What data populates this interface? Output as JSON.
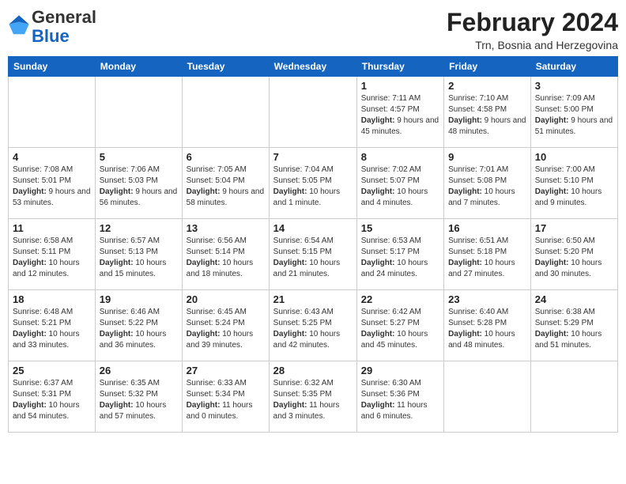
{
  "header": {
    "logo_general": "General",
    "logo_blue": "Blue",
    "month_year": "February 2024",
    "location": "Trn, Bosnia and Herzegovina"
  },
  "weekdays": [
    "Sunday",
    "Monday",
    "Tuesday",
    "Wednesday",
    "Thursday",
    "Friday",
    "Saturday"
  ],
  "weeks": [
    [
      {
        "day": "",
        "info": ""
      },
      {
        "day": "",
        "info": ""
      },
      {
        "day": "",
        "info": ""
      },
      {
        "day": "",
        "info": ""
      },
      {
        "day": "1",
        "sunrise": "Sunrise: 7:11 AM",
        "sunset": "Sunset: 4:57 PM",
        "daylight": "Daylight: 9 hours and 45 minutes."
      },
      {
        "day": "2",
        "sunrise": "Sunrise: 7:10 AM",
        "sunset": "Sunset: 4:58 PM",
        "daylight": "Daylight: 9 hours and 48 minutes."
      },
      {
        "day": "3",
        "sunrise": "Sunrise: 7:09 AM",
        "sunset": "Sunset: 5:00 PM",
        "daylight": "Daylight: 9 hours and 51 minutes."
      }
    ],
    [
      {
        "day": "4",
        "sunrise": "Sunrise: 7:08 AM",
        "sunset": "Sunset: 5:01 PM",
        "daylight": "Daylight: 9 hours and 53 minutes."
      },
      {
        "day": "5",
        "sunrise": "Sunrise: 7:06 AM",
        "sunset": "Sunset: 5:03 PM",
        "daylight": "Daylight: 9 hours and 56 minutes."
      },
      {
        "day": "6",
        "sunrise": "Sunrise: 7:05 AM",
        "sunset": "Sunset: 5:04 PM",
        "daylight": "Daylight: 9 hours and 58 minutes."
      },
      {
        "day": "7",
        "sunrise": "Sunrise: 7:04 AM",
        "sunset": "Sunset: 5:05 PM",
        "daylight": "Daylight: 10 hours and 1 minute."
      },
      {
        "day": "8",
        "sunrise": "Sunrise: 7:02 AM",
        "sunset": "Sunset: 5:07 PM",
        "daylight": "Daylight: 10 hours and 4 minutes."
      },
      {
        "day": "9",
        "sunrise": "Sunrise: 7:01 AM",
        "sunset": "Sunset: 5:08 PM",
        "daylight": "Daylight: 10 hours and 7 minutes."
      },
      {
        "day": "10",
        "sunrise": "Sunrise: 7:00 AM",
        "sunset": "Sunset: 5:10 PM",
        "daylight": "Daylight: 10 hours and 9 minutes."
      }
    ],
    [
      {
        "day": "11",
        "sunrise": "Sunrise: 6:58 AM",
        "sunset": "Sunset: 5:11 PM",
        "daylight": "Daylight: 10 hours and 12 minutes."
      },
      {
        "day": "12",
        "sunrise": "Sunrise: 6:57 AM",
        "sunset": "Sunset: 5:13 PM",
        "daylight": "Daylight: 10 hours and 15 minutes."
      },
      {
        "day": "13",
        "sunrise": "Sunrise: 6:56 AM",
        "sunset": "Sunset: 5:14 PM",
        "daylight": "Daylight: 10 hours and 18 minutes."
      },
      {
        "day": "14",
        "sunrise": "Sunrise: 6:54 AM",
        "sunset": "Sunset: 5:15 PM",
        "daylight": "Daylight: 10 hours and 21 minutes."
      },
      {
        "day": "15",
        "sunrise": "Sunrise: 6:53 AM",
        "sunset": "Sunset: 5:17 PM",
        "daylight": "Daylight: 10 hours and 24 minutes."
      },
      {
        "day": "16",
        "sunrise": "Sunrise: 6:51 AM",
        "sunset": "Sunset: 5:18 PM",
        "daylight": "Daylight: 10 hours and 27 minutes."
      },
      {
        "day": "17",
        "sunrise": "Sunrise: 6:50 AM",
        "sunset": "Sunset: 5:20 PM",
        "daylight": "Daylight: 10 hours and 30 minutes."
      }
    ],
    [
      {
        "day": "18",
        "sunrise": "Sunrise: 6:48 AM",
        "sunset": "Sunset: 5:21 PM",
        "daylight": "Daylight: 10 hours and 33 minutes."
      },
      {
        "day": "19",
        "sunrise": "Sunrise: 6:46 AM",
        "sunset": "Sunset: 5:22 PM",
        "daylight": "Daylight: 10 hours and 36 minutes."
      },
      {
        "day": "20",
        "sunrise": "Sunrise: 6:45 AM",
        "sunset": "Sunset: 5:24 PM",
        "daylight": "Daylight: 10 hours and 39 minutes."
      },
      {
        "day": "21",
        "sunrise": "Sunrise: 6:43 AM",
        "sunset": "Sunset: 5:25 PM",
        "daylight": "Daylight: 10 hours and 42 minutes."
      },
      {
        "day": "22",
        "sunrise": "Sunrise: 6:42 AM",
        "sunset": "Sunset: 5:27 PM",
        "daylight": "Daylight: 10 hours and 45 minutes."
      },
      {
        "day": "23",
        "sunrise": "Sunrise: 6:40 AM",
        "sunset": "Sunset: 5:28 PM",
        "daylight": "Daylight: 10 hours and 48 minutes."
      },
      {
        "day": "24",
        "sunrise": "Sunrise: 6:38 AM",
        "sunset": "Sunset: 5:29 PM",
        "daylight": "Daylight: 10 hours and 51 minutes."
      }
    ],
    [
      {
        "day": "25",
        "sunrise": "Sunrise: 6:37 AM",
        "sunset": "Sunset: 5:31 PM",
        "daylight": "Daylight: 10 hours and 54 minutes."
      },
      {
        "day": "26",
        "sunrise": "Sunrise: 6:35 AM",
        "sunset": "Sunset: 5:32 PM",
        "daylight": "Daylight: 10 hours and 57 minutes."
      },
      {
        "day": "27",
        "sunrise": "Sunrise: 6:33 AM",
        "sunset": "Sunset: 5:34 PM",
        "daylight": "Daylight: 11 hours and 0 minutes."
      },
      {
        "day": "28",
        "sunrise": "Sunrise: 6:32 AM",
        "sunset": "Sunset: 5:35 PM",
        "daylight": "Daylight: 11 hours and 3 minutes."
      },
      {
        "day": "29",
        "sunrise": "Sunrise: 6:30 AM",
        "sunset": "Sunset: 5:36 PM",
        "daylight": "Daylight: 11 hours and 6 minutes."
      },
      {
        "day": "",
        "info": ""
      },
      {
        "day": "",
        "info": ""
      }
    ]
  ]
}
